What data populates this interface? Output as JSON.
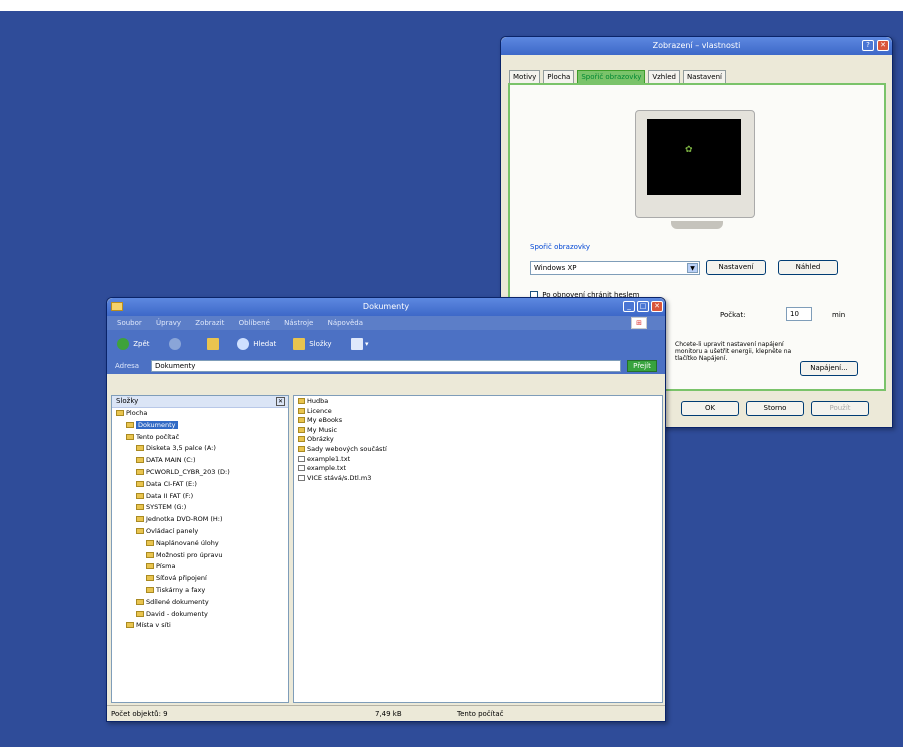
{
  "dialog": {
    "title": "Zobrazení – vlastnosti",
    "tabs": [
      "Motivy",
      "Plocha",
      "Spořič obrazovky",
      "Vzhled",
      "Nastavení"
    ],
    "active_tab": "Spořič obrazovky",
    "screensaver_group_label": "Spořič obrazovky",
    "screensaver_value": "Windows XP",
    "settings_button": "Nastavení",
    "preview_button": "Náhled",
    "password_checkbox": "Po obnovení chránit heslem",
    "wait_label": "Počkat:",
    "wait_value": "10",
    "wait_unit": "min",
    "power_text": "Chcete-li upravit nastavení napájení monitoru a ušetřit energii, klepněte na tlačítko Napájení.",
    "power_button": "Napájení...",
    "ok_button": "OK",
    "cancel_button": "Storno",
    "apply_button": "Použít"
  },
  "explorer": {
    "title": "Dokumenty",
    "menu": [
      "Soubor",
      "Úpravy",
      "Zobrazit",
      "Oblíbené",
      "Nástroje",
      "Nápověda"
    ],
    "toolbar": {
      "back": "Zpět",
      "search": "Hledat",
      "folders": "Složky"
    },
    "address_label": "Adresa",
    "address_value": "Dokumenty",
    "go_button": "Přejít",
    "tree_header": "Složky",
    "tree": [
      {
        "label": "Plocha",
        "indent": 0
      },
      {
        "label": "Dokumenty",
        "indent": 1,
        "selected": true
      },
      {
        "label": "Tento počítač",
        "indent": 1
      },
      {
        "label": "Disketa 3,5 palce (A:)",
        "indent": 2
      },
      {
        "label": "DATA MAIN (C:)",
        "indent": 2
      },
      {
        "label": "PCWORLD_CYBR_203 (D:)",
        "indent": 2
      },
      {
        "label": "Data CI-FAT (E:)",
        "indent": 2
      },
      {
        "label": "Data II FAT (F:)",
        "indent": 2
      },
      {
        "label": "SYSTEM (G:)",
        "indent": 2
      },
      {
        "label": "Jednotka DVD-ROM (H:)",
        "indent": 2
      },
      {
        "label": "Ovládací panely",
        "indent": 2
      },
      {
        "label": "Naplánované úlohy",
        "indent": 3
      },
      {
        "label": "Možnosti pro úpravu",
        "indent": 3
      },
      {
        "label": "Písma",
        "indent": 3
      },
      {
        "label": "Síťová připojení",
        "indent": 3
      },
      {
        "label": "Tiskárny a faxy",
        "indent": 3
      },
      {
        "label": "Sdílené dokumenty",
        "indent": 2
      },
      {
        "label": "David - dokumenty",
        "indent": 2
      },
      {
        "label": "Místa v síti",
        "indent": 1
      }
    ],
    "files": [
      "Hudba",
      "Licence",
      "My eBooks",
      "My Music",
      "Obrázky",
      "Sady webových součástí",
      "example1.txt",
      "example.txt",
      "VICE stává/s.Dtl.m3"
    ],
    "status_left": "Počet objektů: 9",
    "status_size": "7,49 kB",
    "status_location": "Tento počítač"
  }
}
